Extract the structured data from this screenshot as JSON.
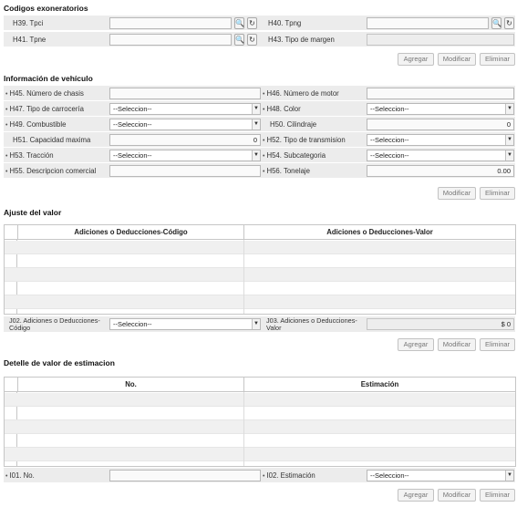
{
  "codigos": {
    "title": "Codigos exoneratorios",
    "h39": "H39. Tpci",
    "h40": "H40. Tpng",
    "h41": "H41. Tpne",
    "h43": "H43. Tipo de margen"
  },
  "buttons": {
    "agregar": "Agregar",
    "modificar": "Modificar",
    "eliminar": "Eliminar"
  },
  "vehiculo": {
    "title": "Información de vehículo",
    "h45": "H45. Número de chasis",
    "h46": "H46. Número de motor",
    "h47": "H47. Tipo de carrocería",
    "h47_value": "--Seleccion--",
    "h48": "H48. Color",
    "h48_value": "--Seleccion--",
    "h49": "H49. Combustible",
    "h49_value": "--Seleccion--",
    "h50": "H50. Cilindraje",
    "h50_value": "0",
    "h51": "H51. Capacidad maxima",
    "h51_value": "0",
    "h52": "H52. Tipo de transmision",
    "h52_value": "--Seleccion--",
    "h53": "H53. Tracción",
    "h53_value": "--Seleccion--",
    "h54": "H54. Subcategoria",
    "h54_value": "--Seleccion--",
    "h55": "H55. Descripcion comercial",
    "h56": "H56. Tonelaje",
    "h56_value": "0.00"
  },
  "ajuste": {
    "title": "Ajuste del valor",
    "col1": "Adiciones o Deducciones-Código",
    "col2": "Adiciones o Deducciones-Valor",
    "j02": "J02. Adiciones o Deducciones-Código",
    "j02_value": "--Seleccion--",
    "j03": "J03. Adiciones o Deducciones-Valor",
    "j03_value": "$ 0"
  },
  "detalle": {
    "title": "Detelle de valor de estimacion",
    "col1": "No.",
    "col2": "Estimación",
    "i01": "I01. No.",
    "i02": "I02. Estimación",
    "i02_value": "--Seleccion--"
  },
  "icons": {
    "search": "🔍",
    "reset": "↻",
    "dropdown": "▼",
    "required": "•"
  }
}
